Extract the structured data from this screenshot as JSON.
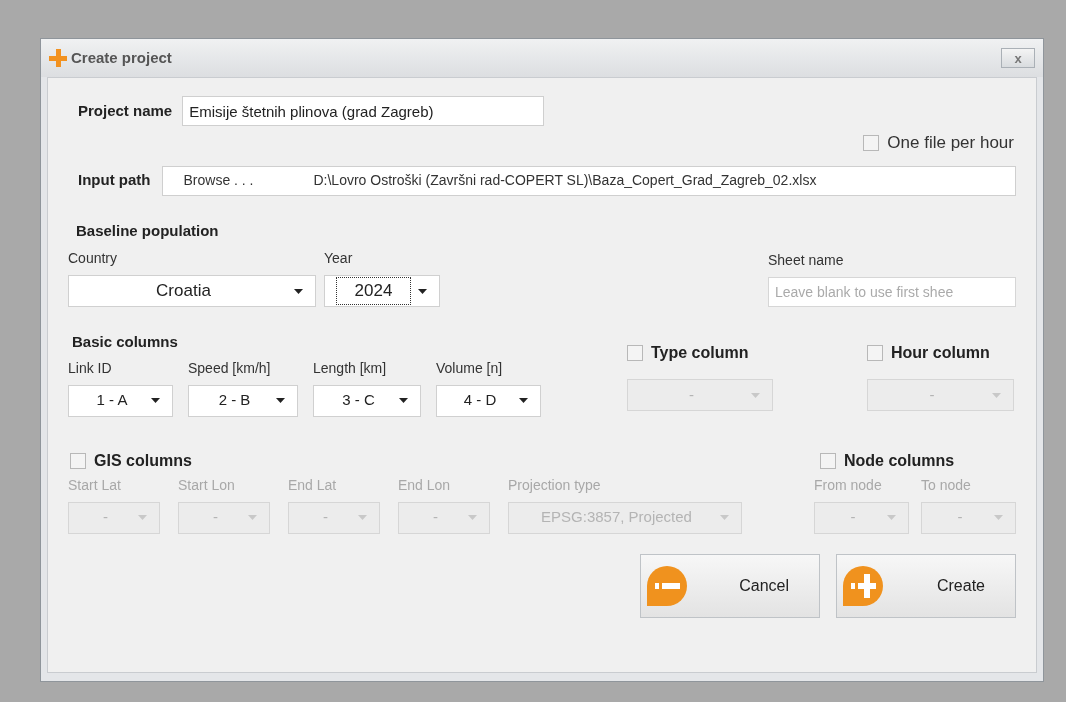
{
  "window": {
    "title": "Create project",
    "close": "x"
  },
  "project_name": {
    "label": "Project name",
    "value": "Emisije štetnih plinova (grad Zagreb)"
  },
  "one_file_per_hour": {
    "label": "One file per hour",
    "checked": false
  },
  "input_path": {
    "label": "Input path",
    "button": "Browse . . .",
    "value": "D:\\Lovro Ostroški (Završni rad-COPERT SL)\\Baza_Copert_Grad_Zagreb_02.xlsx"
  },
  "baseline_population": {
    "title": "Baseline population",
    "country": {
      "label": "Country",
      "value": "Croatia",
      "focused": false
    },
    "year": {
      "label": "Year",
      "value": "2024",
      "focused": true
    }
  },
  "sheet_name": {
    "label": "Sheet name",
    "placeholder": "Leave blank to use first shee"
  },
  "basic_columns": {
    "title": "Basic columns",
    "fields": [
      {
        "label": "Link ID",
        "value": "1 - A",
        "disabled": false
      },
      {
        "label": "Speed [km/h]",
        "value": "2 - B",
        "disabled": false
      },
      {
        "label": "Length [km]",
        "value": "3 - C",
        "disabled": false
      },
      {
        "label": "Volume [n]",
        "value": "4 - D",
        "disabled": false
      }
    ]
  },
  "type_column": {
    "label": "Type column",
    "checked": false,
    "value": "-",
    "disabled": true
  },
  "hour_column": {
    "label": "Hour column",
    "checked": false,
    "value": "-",
    "disabled": true
  },
  "gis_columns": {
    "label": "GIS columns",
    "checked": false,
    "fields": [
      {
        "label": "Start Lat",
        "value": "-",
        "disabled": true
      },
      {
        "label": "Start Lon",
        "value": "-",
        "disabled": true
      },
      {
        "label": "End Lat",
        "value": "-",
        "disabled": true
      },
      {
        "label": "End Lon",
        "value": "-",
        "disabled": true
      },
      {
        "label": "Projection type",
        "value": "EPSG:3857, Projected",
        "disabled": true
      }
    ]
  },
  "node_columns": {
    "label": "Node columns",
    "checked": false,
    "fields": [
      {
        "label": "From node",
        "value": "-",
        "disabled": true
      },
      {
        "label": "To node",
        "value": "-",
        "disabled": true
      }
    ]
  },
  "buttons": [
    {
      "kind": "cancel",
      "label": "Cancel"
    },
    {
      "kind": "create",
      "label": "Create"
    }
  ]
}
